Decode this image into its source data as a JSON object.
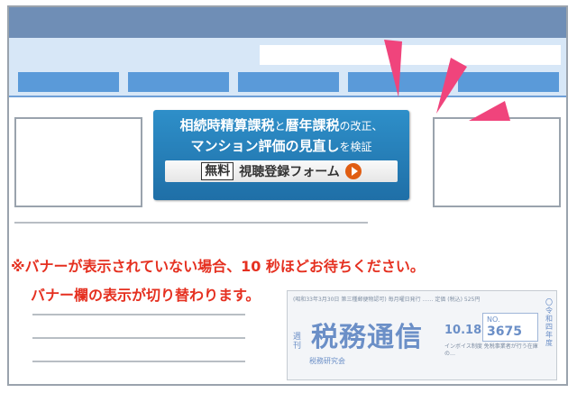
{
  "banner": {
    "line1_bold1": "相続時精算課税",
    "line1_mid": "と",
    "line1_bold2": "暦年課税",
    "line1_tail": "の改正、",
    "line2_bold": "マンション評価の見直し",
    "line2_tail": "を検証",
    "free_label": "無料",
    "cta_label": "視聴登録フォーム"
  },
  "notice": {
    "line1": "※バナーが表示されていない場合、10 秒ほどお待ちください。",
    "line2": "バナー欄の表示が切り替わります。"
  },
  "magazine": {
    "header_text": "(昭和33年3月30日 第三種郵便物認可) 毎月曜日発行 …… 定価 (税込) 525円",
    "title": "税務通信",
    "kanji_sub": "週刊",
    "publisher": "税務研究会",
    "date": "10.18.",
    "no_label": "NO.",
    "number": "3675",
    "body_text": "インボイス制度 免税事業者が行う在庫の…",
    "side_text": "〇令和四年度"
  },
  "colors": {
    "topbar": "#6f8eb6",
    "header": "#d7e7f7",
    "nav_tab": "#5a9ad9",
    "banner": "#2380bd",
    "notice": "#e53020",
    "arrow": "#f0447c"
  },
  "icons": [
    "play-icon",
    "pointer-arrow-icon"
  ]
}
